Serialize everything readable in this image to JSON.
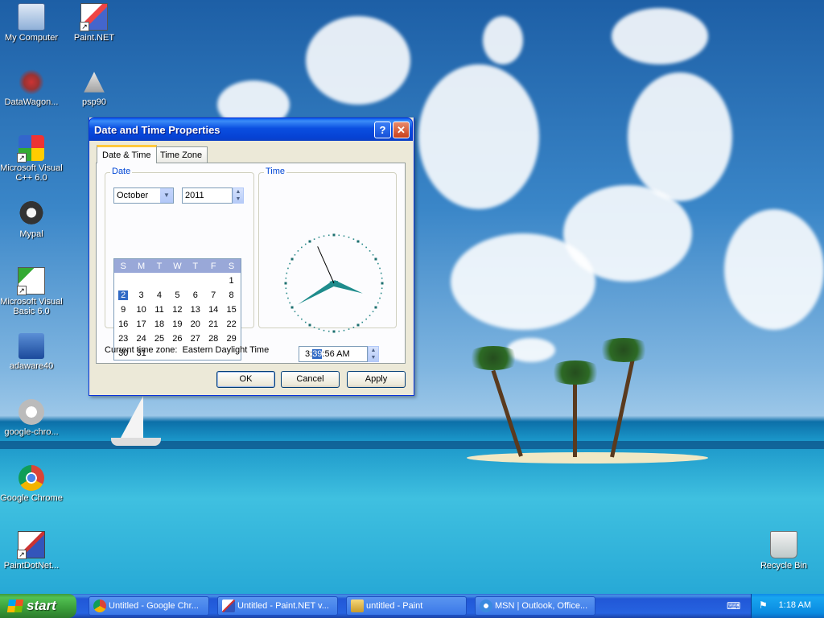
{
  "desktop": {
    "icons": [
      {
        "label": "My Computer",
        "icon": "computer-icon"
      },
      {
        "label": "Paint.NET",
        "icon": "paintnet-icon"
      },
      {
        "label": "DataWagon...",
        "icon": "datawagon-icon"
      },
      {
        "label": "psp90",
        "icon": "psp-icon"
      },
      {
        "label": "Microsoft Visual C++ 6.0",
        "icon": "visual-cpp-icon"
      },
      {
        "label": "Mypal",
        "icon": "mypal-icon"
      },
      {
        "label": "Microsoft Visual Basic 6.0",
        "icon": "visual-basic-icon"
      },
      {
        "label": "adaware40",
        "icon": "adaware-icon"
      },
      {
        "label": "google-chro...",
        "icon": "installer-disc-icon"
      },
      {
        "label": "Google Chrome",
        "icon": "chrome-icon"
      },
      {
        "label": "PaintDotNet...",
        "icon": "paintdotnet-icon"
      },
      {
        "label": "Recycle Bin",
        "icon": "recycle-bin-icon"
      }
    ]
  },
  "dialog": {
    "title": "Date and Time Properties",
    "help_label": "?",
    "close_label": "✕",
    "tabs": [
      {
        "label": "Date & Time",
        "active": true
      },
      {
        "label": "Time Zone",
        "active": false
      }
    ],
    "date_group_label": "Date",
    "month": "October",
    "year": "2011",
    "calendar": {
      "weekdays": [
        "S",
        "M",
        "T",
        "W",
        "T",
        "F",
        "S"
      ],
      "weeks": [
        [
          "",
          "",
          "",
          "",
          "",
          "",
          "1"
        ],
        [
          "2",
          "3",
          "4",
          "5",
          "6",
          "7",
          "8"
        ],
        [
          "9",
          "10",
          "11",
          "12",
          "13",
          "14",
          "15"
        ],
        [
          "16",
          "17",
          "18",
          "19",
          "20",
          "21",
          "22"
        ],
        [
          "23",
          "24",
          "25",
          "26",
          "27",
          "28",
          "29"
        ],
        [
          "30",
          "31",
          "",
          "",
          "",
          "",
          ""
        ]
      ],
      "selected_day": "2"
    },
    "time_group_label": "Time",
    "time": {
      "hour": "3",
      "sep1": ":",
      "minute": "39",
      "rest": ":56 AM"
    },
    "clock": {
      "hour": 3,
      "minute": 39,
      "second": 56
    },
    "current_zone_text": "Current time zone:  Eastern Daylight Time",
    "buttons": {
      "ok": "OK",
      "cancel": "Cancel",
      "apply": "Apply"
    }
  },
  "taskbar": {
    "start_label": "start",
    "tasks": [
      {
        "label": "Untitled - Google Chr...",
        "icon": "chrome-icon"
      },
      {
        "label": "Untitled - Paint.NET v...",
        "icon": "paintnet-icon"
      },
      {
        "label": "untitled - Paint",
        "icon": "paint-icon"
      },
      {
        "label": "MSN | Outlook, Office...",
        "icon": "internet-explorer-icon"
      }
    ],
    "keyboard_glyph": "⌨",
    "tray_glyph": "⚑",
    "clock": "1:18 AM"
  },
  "colors": {
    "title_blue": "#0a4ee0",
    "tab_highlight": "#ffc83c",
    "group_label": "#0046d5",
    "calendar_header": "#99a8d8",
    "selection": "#316ac5",
    "clock_hand": "#1f8c8c"
  }
}
